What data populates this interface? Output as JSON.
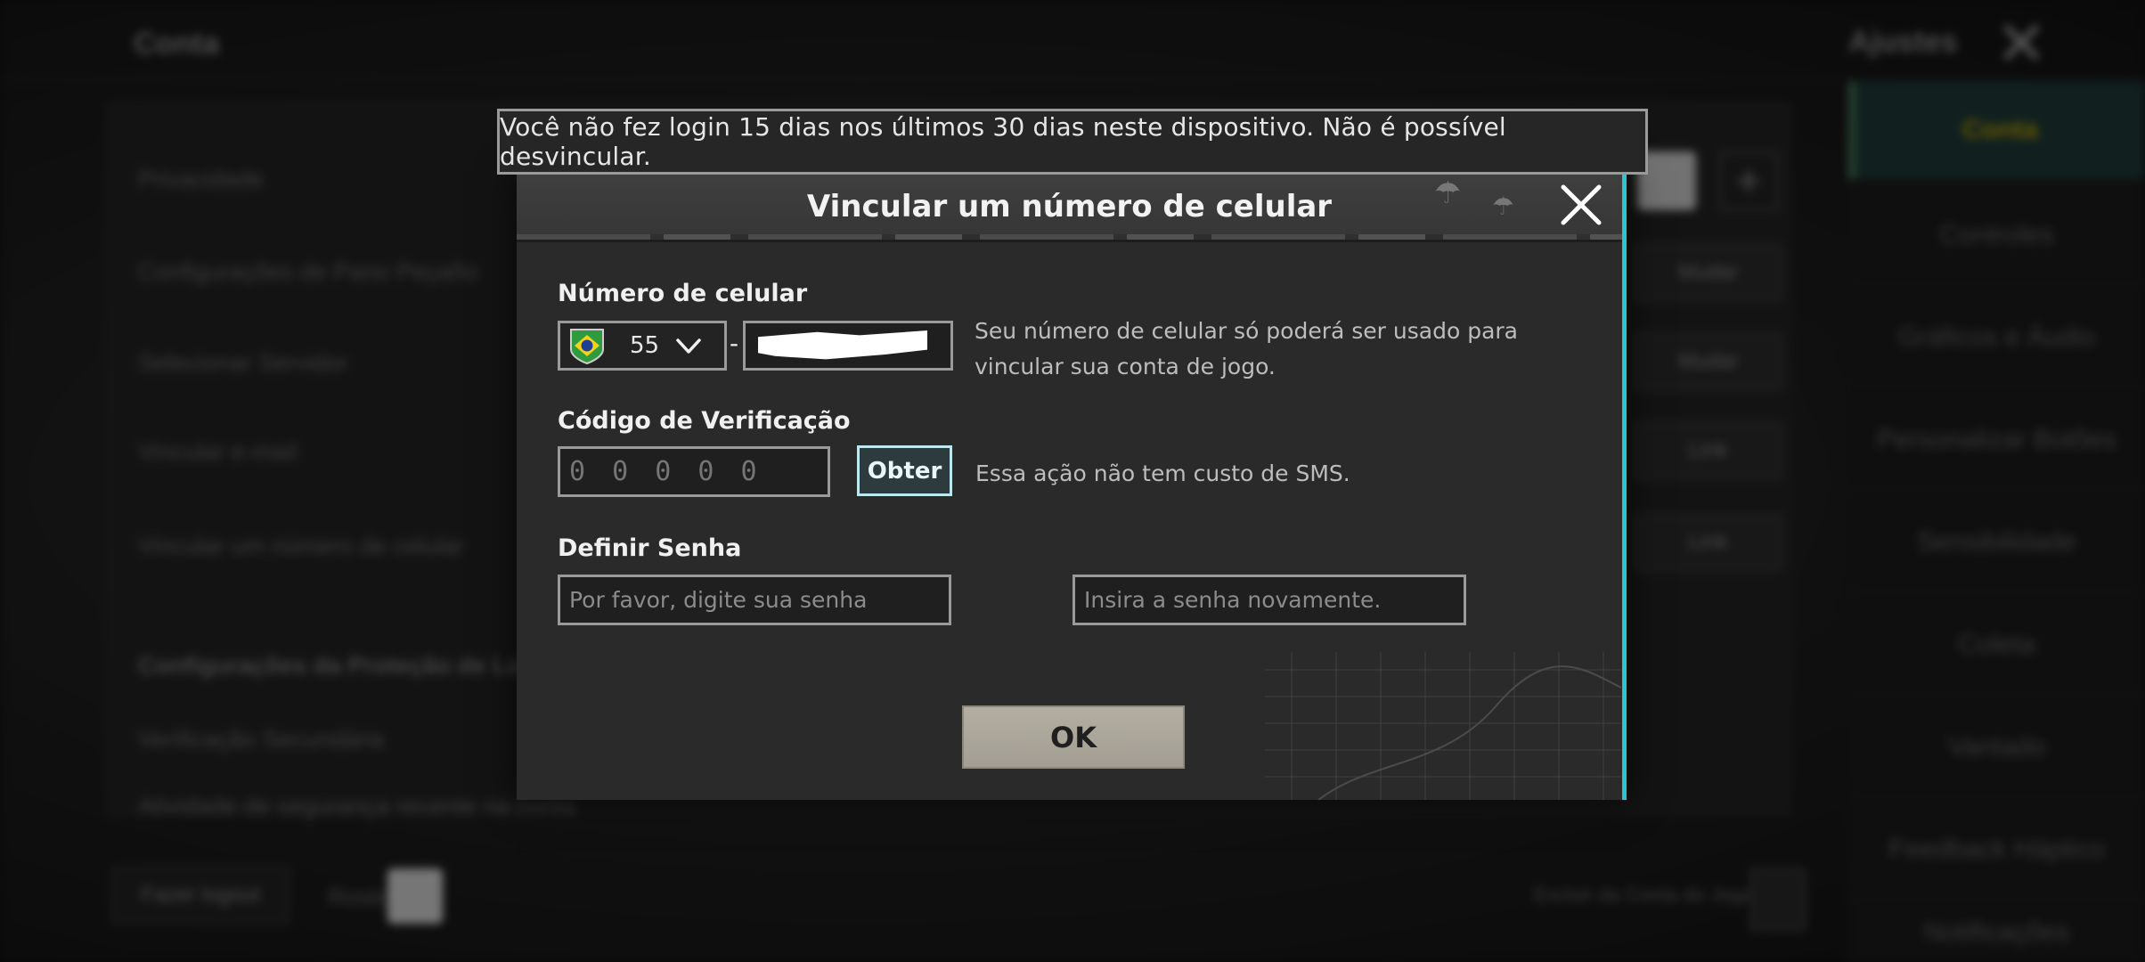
{
  "background": {
    "page_title": "Conta",
    "settings_label": "Ajustes",
    "rows": [
      "Privacidade",
      "Configurações de Pano Peçaño",
      "Selecionar Servidor",
      "Vincular e-mail",
      "Vincular um número de celular",
      "Configurações da Proteção de Login",
      "Verificação Secundária",
      "Atividade de segurança recente na conta"
    ],
    "row_buttons": [
      "Mudar",
      "Mudar",
      "Link",
      "Link"
    ],
    "sidebar": [
      "Conta",
      "Controles",
      "Gráficos e Áudio",
      "Personalizar Botões",
      "Sensibilidade",
      "Coleta",
      "Vantado",
      "Feedback Háptico",
      "Notificações"
    ],
    "bottom_button": "Fazer logout",
    "bottom_label": "Rosto",
    "bottom_right_label": "Excluir da Conta do Jogo"
  },
  "notice": {
    "text": "Você não fez login 15 dias nos últimos 30 dias neste dispositivo. Não é possível desvincular."
  },
  "dialog": {
    "title": "Vincular um número de celular",
    "phone": {
      "label": "Número de celular",
      "country_flag": "brazil-flag",
      "country_code": "55",
      "separator": "-",
      "hint_line1": "Seu número de celular só poderá ser usado para",
      "hint_line2": "vincular sua conta de jogo."
    },
    "verification": {
      "label": "Código de Verificação",
      "placeholder": "0 0 0 0 0",
      "button_label": "Obter",
      "hint": "Essa ação não tem custo de SMS."
    },
    "password": {
      "label": "Definir Senha",
      "placeholder": "Por favor, digite sua senha",
      "confirm_placeholder": "Insira a senha novamente."
    },
    "ok_label": "OK"
  },
  "colors": {
    "accent_border": "#2ec4cf",
    "ok_button": "#aba69b",
    "obter_border": "#bfe8ee"
  }
}
